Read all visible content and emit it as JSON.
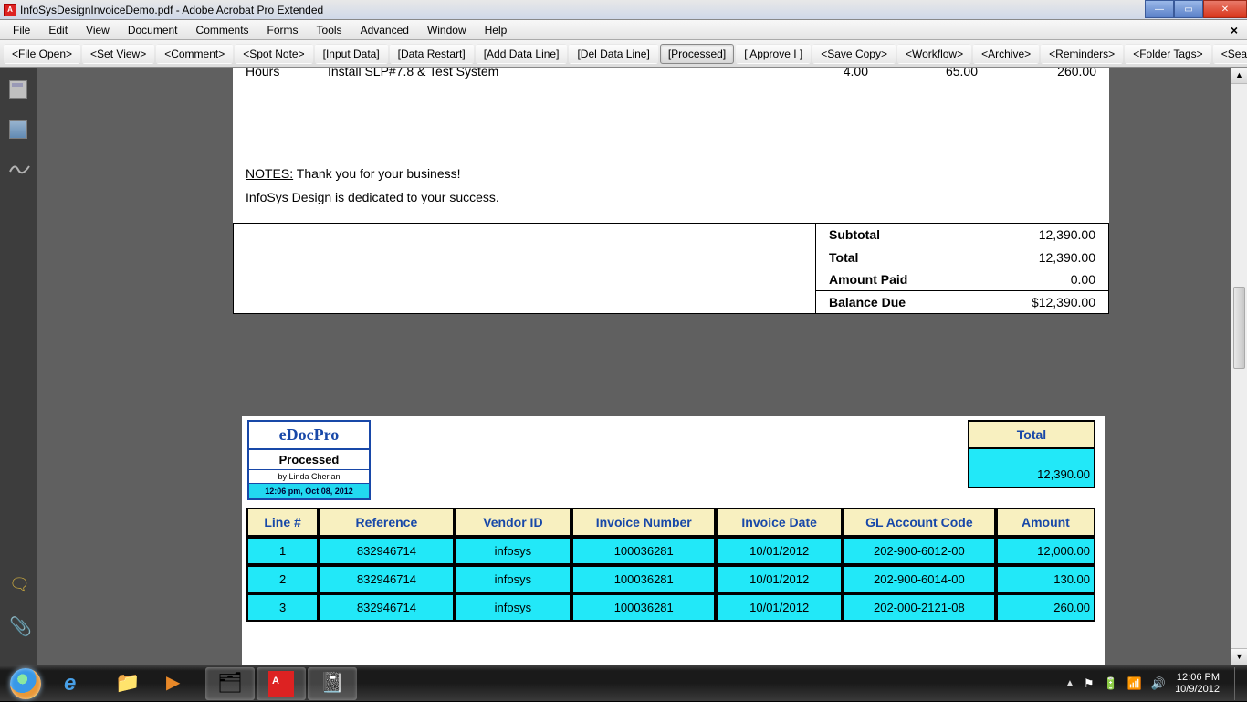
{
  "window": {
    "title": "InfoSysDesignInvoiceDemo.pdf - Adobe Acrobat Pro Extended"
  },
  "menu": [
    "File",
    "Edit",
    "View",
    "Document",
    "Comments",
    "Forms",
    "Tools",
    "Advanced",
    "Window",
    "Help"
  ],
  "toolbar": [
    {
      "label": "<File Open>",
      "active": false
    },
    {
      "label": "<Set View>",
      "active": false
    },
    {
      "label": "<Comment>",
      "active": false
    },
    {
      "label": "<Spot Note>",
      "active": false
    },
    {
      "label": "[Input Data]",
      "active": false
    },
    {
      "label": "[Data Restart]",
      "active": false
    },
    {
      "label": "[Add Data Line]",
      "active": false
    },
    {
      "label": "[Del Data Line]",
      "active": false
    },
    {
      "label": "[Processed]",
      "active": true
    },
    {
      "label": "[ Approve I ]",
      "active": false
    },
    {
      "label": "<Save Copy>",
      "active": false
    },
    {
      "label": "<Workflow>",
      "active": false
    },
    {
      "label": "<Archive>",
      "active": false
    },
    {
      "label": "<Reminders>",
      "active": false
    },
    {
      "label": "<Folder Tags>",
      "active": false
    },
    {
      "label": "<Search>",
      "active": false
    }
  ],
  "invoice": {
    "line": {
      "unit": "Hours",
      "desc": "Install SLP#7.8 & Test System",
      "qty": "4.00",
      "rate": "65.00",
      "amount": "260.00"
    },
    "notes_label": "NOTES:",
    "notes_text": " Thank you for your business!",
    "notes2": "InfoSys Design is dedicated to your success.",
    "totals": {
      "subtotal_label": "Subtotal",
      "subtotal": "12,390.00",
      "total_label": "Total",
      "total": "12,390.00",
      "paid_label": "Amount Paid",
      "paid": "0.00",
      "balance_label": "Balance Due",
      "balance": "$12,390.00"
    }
  },
  "edoc": {
    "brand": "eDocPro",
    "status": "Processed",
    "by": "by Linda Cherian",
    "timestamp": "12:06 pm, Oct 08, 2012",
    "total_label": "Total",
    "total_value": "12,390.00",
    "headers": [
      "Line #",
      "Reference",
      "Vendor ID",
      "Invoice Number",
      "Invoice Date",
      "GL Account Code",
      "Amount"
    ],
    "rows": [
      {
        "line": "1",
        "ref": "832946714",
        "vendor": "infosys",
        "invno": "100036281",
        "invdate": "10/01/2012",
        "gl": "202-900-6012-00",
        "amt": "12,000.00"
      },
      {
        "line": "2",
        "ref": "832946714",
        "vendor": "infosys",
        "invno": "100036281",
        "invdate": "10/01/2012",
        "gl": "202-900-6014-00",
        "amt": "130.00"
      },
      {
        "line": "3",
        "ref": "832946714",
        "vendor": "infosys",
        "invno": "100036281",
        "invdate": "10/01/2012",
        "gl": "202-000-2121-08",
        "amt": "260.00"
      }
    ]
  },
  "tray": {
    "time": "12:06 PM",
    "date": "10/9/2012"
  }
}
